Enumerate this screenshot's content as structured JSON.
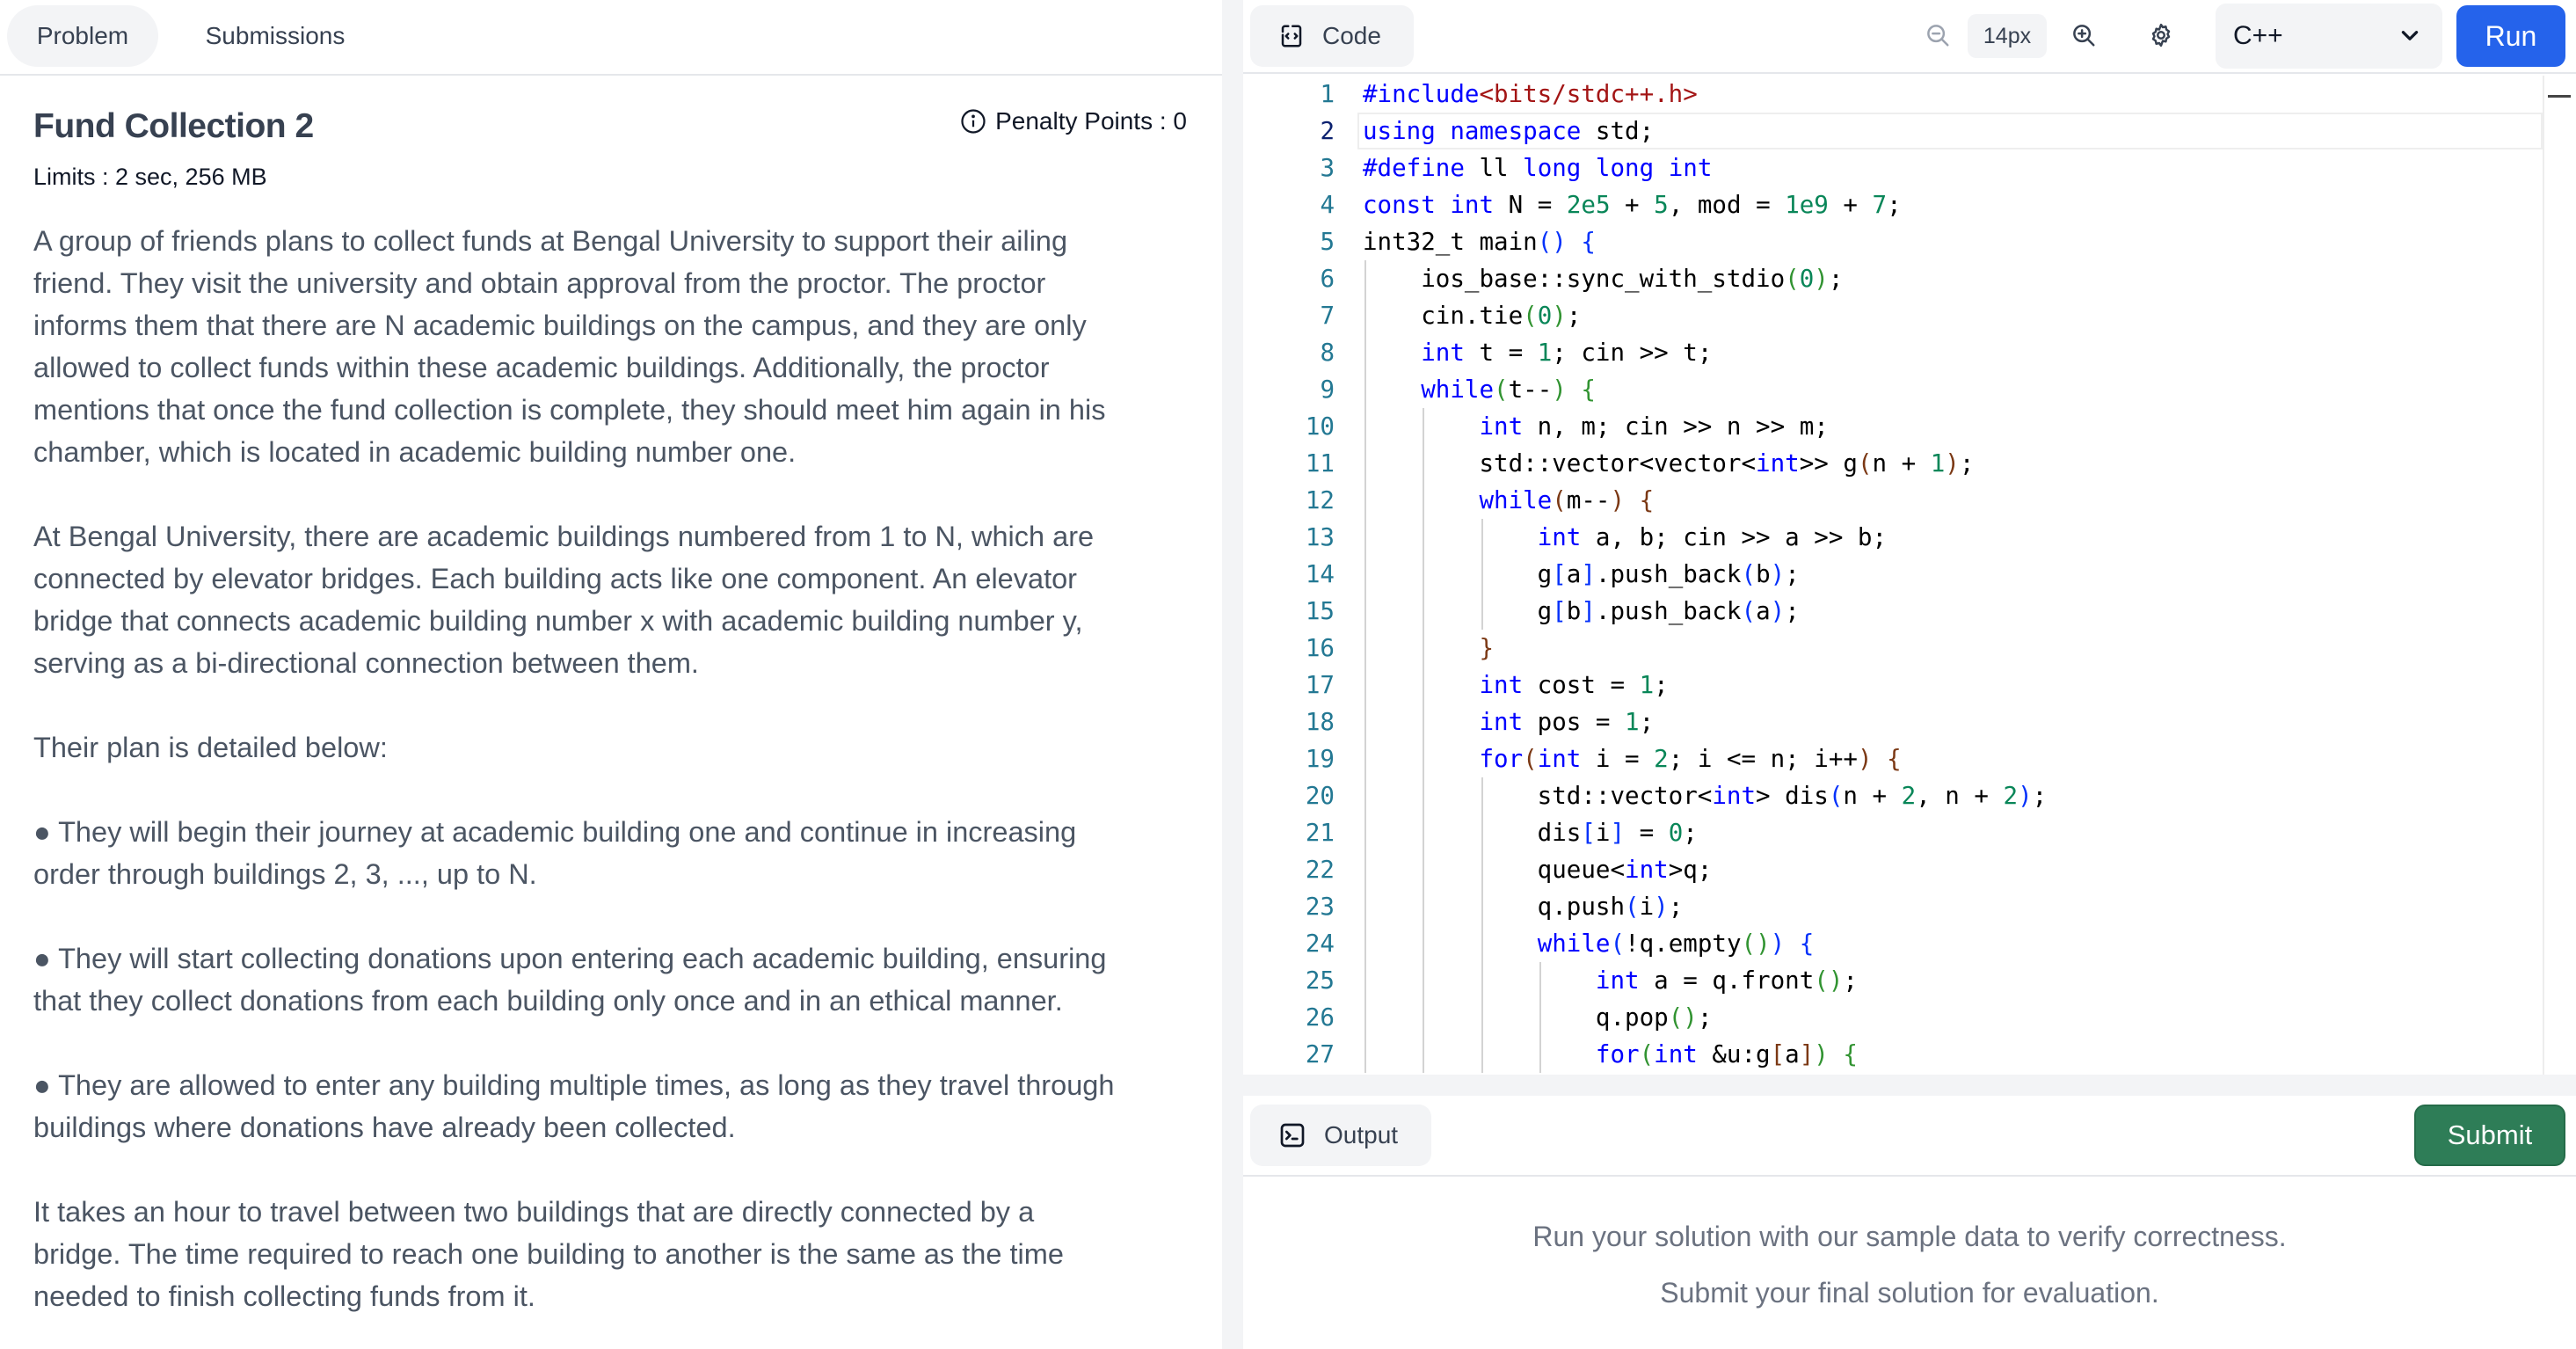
{
  "tabs": {
    "problem": "Problem",
    "submissions": "Submissions"
  },
  "problem": {
    "title": "Fund Collection 2",
    "limits": "Limits : 2 sec, 256 MB",
    "penalty": "Penalty Points : 0",
    "paragraphs": [
      "A group of friends plans to collect funds at Bengal University to support their ailing\nfriend. They visit the university and obtain approval from the proctor. The proctor\ninforms them that there are N academic buildings on the campus, and they are only\nallowed to collect funds within these academic buildings. Additionally, the proctor\nmentions that once the fund collection is complete, they should meet him again in his\nchamber, which is located in academic building number one.",
      "At Bengal University, there are academic buildings numbered from 1 to N, which are\nconnected by elevator bridges. Each building acts like one component. An elevator\nbridge that connects academic building number x with academic building number y,\nserving as a bi-directional connection between them.",
      "Their plan is detailed below:",
      "● They will begin their journey at academic building one and continue in increasing\norder through buildings 2, 3, ..., up to N.",
      "● They will start collecting donations upon entering each academic building, ensuring\nthat they collect donations from each building only once and in an ethical manner.",
      "● They are allowed to enter any building multiple times, as long as they travel through\nbuildings where donations have already been collected.",
      "It takes an hour to travel between two buildings that are directly connected by a\nbridge. The time required to reach one building to another is the same as the time\nneeded to finish collecting funds from it."
    ]
  },
  "editor_toolbar": {
    "code_tab": "Code",
    "font_size": "14px",
    "language": "C++",
    "run": "Run",
    "icons": [
      "code-icon",
      "zoom-out-icon",
      "zoom-in-icon",
      "gear-icon",
      "chevron-down-icon"
    ]
  },
  "editor": {
    "current_line": 2,
    "lines": [
      "#include<bits/stdc++.h>",
      "using namespace std;",
      "#define ll long long int",
      "const int N = 2e5 + 5, mod = 1e9 + 7;",
      "int32_t main() {",
      "    ios_base::sync_with_stdio(0);",
      "    cin.tie(0);",
      "    int t = 1; cin >> t;",
      "    while(t--) {",
      "        int n, m; cin >> n >> m;",
      "        std::vector<vector<int>> g(n + 1);",
      "        while(m--) {",
      "            int a, b; cin >> a >> b;",
      "            g[a].push_back(b);",
      "            g[b].push_back(a);",
      "        }",
      "        int cost = 1;",
      "        int pos = 1;",
      "        for(int i = 2; i <= n; i++) {",
      "            std::vector<int> dis(n + 2, n + 2);",
      "            dis[i] = 0;",
      "            queue<int>q;",
      "            q.push(i);",
      "            while(!q.empty()) {",
      "                int a = q.front();",
      "                q.pop();",
      "                for(int &u:g[a]) {"
    ]
  },
  "output": {
    "tab": "Output",
    "submit": "Submit",
    "message_1": "Run your solution with our sample data to verify correctness.",
    "message_2": "Submit your final solution for evaluation."
  },
  "colors": {
    "run_button": "#2563eb",
    "submit_button": "#2e7d57",
    "keyword": "#0000ff",
    "string": "#a31515",
    "number": "#098658",
    "line_number": "#237893"
  }
}
